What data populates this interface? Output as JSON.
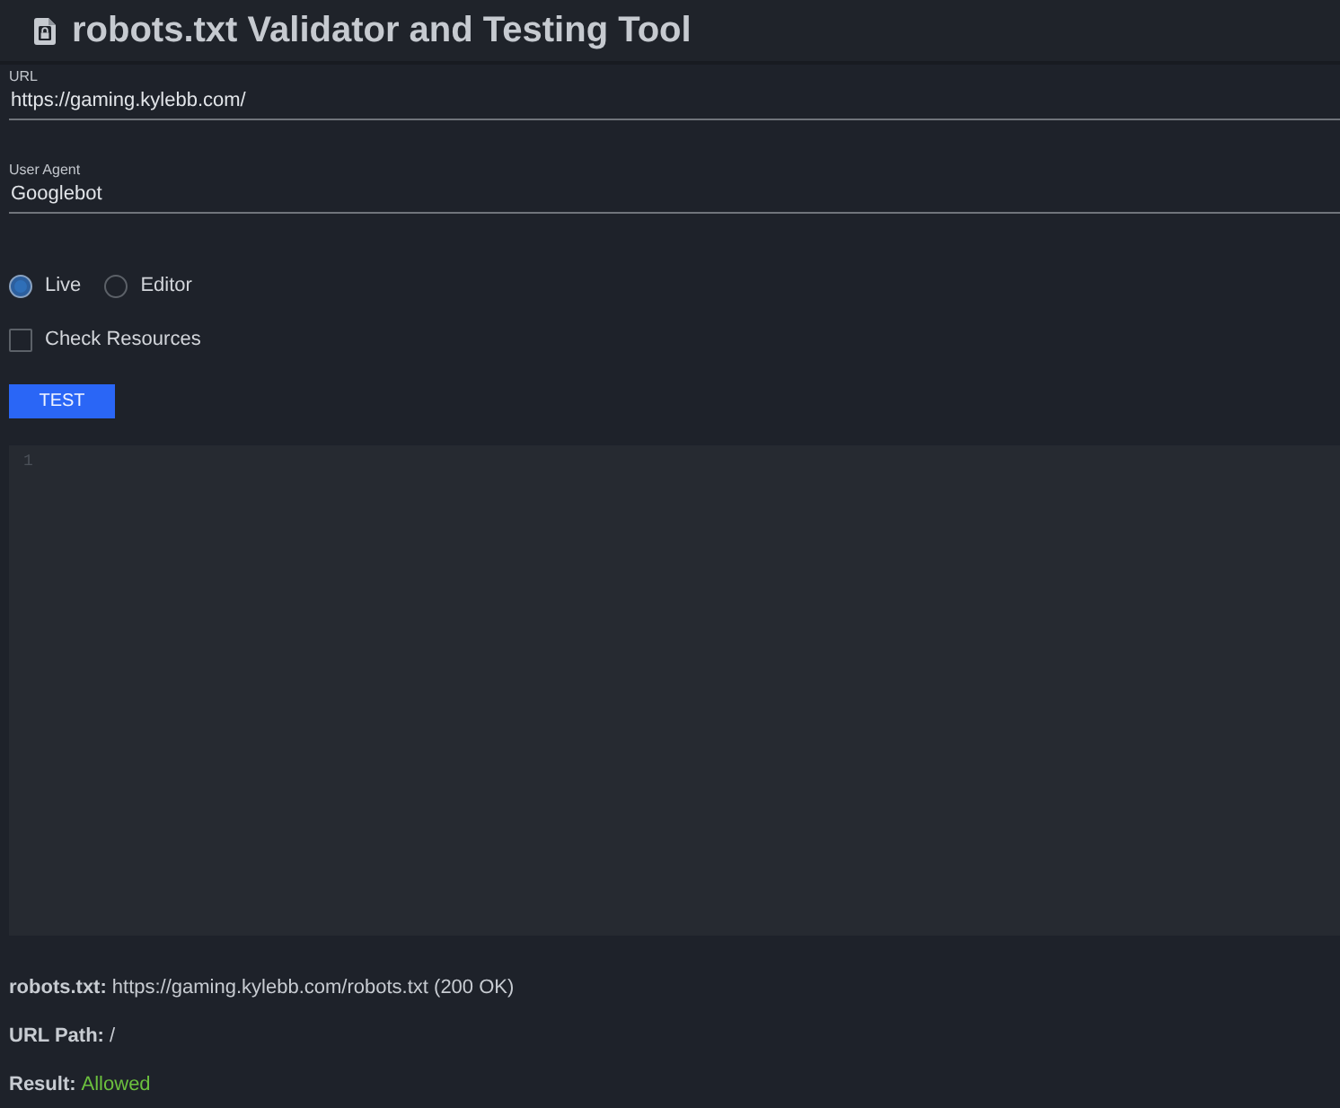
{
  "header": {
    "title": "robots.txt Validator and Testing Tool"
  },
  "fields": [
    {
      "label": "URL",
      "value": "https://gaming.kylebb.com/"
    },
    {
      "label": "User Agent",
      "value": "Googlebot"
    }
  ],
  "mode_options": [
    {
      "label": "Live",
      "selected": true
    },
    {
      "label": "Editor",
      "selected": false
    }
  ],
  "check_resources": {
    "label": "Check Resources",
    "checked": false
  },
  "test_button": {
    "label": "TEST"
  },
  "editor": {
    "line_numbers": [
      "1"
    ]
  },
  "results": [
    {
      "label": "robots.txt:",
      "value": "https://gaming.kylebb.com/robots.txt (200 OK)",
      "kind": "plain"
    },
    {
      "label": "URL Path:",
      "value": "/",
      "kind": "plain"
    },
    {
      "label": "Result:",
      "value": "Allowed",
      "kind": "status"
    }
  ]
}
